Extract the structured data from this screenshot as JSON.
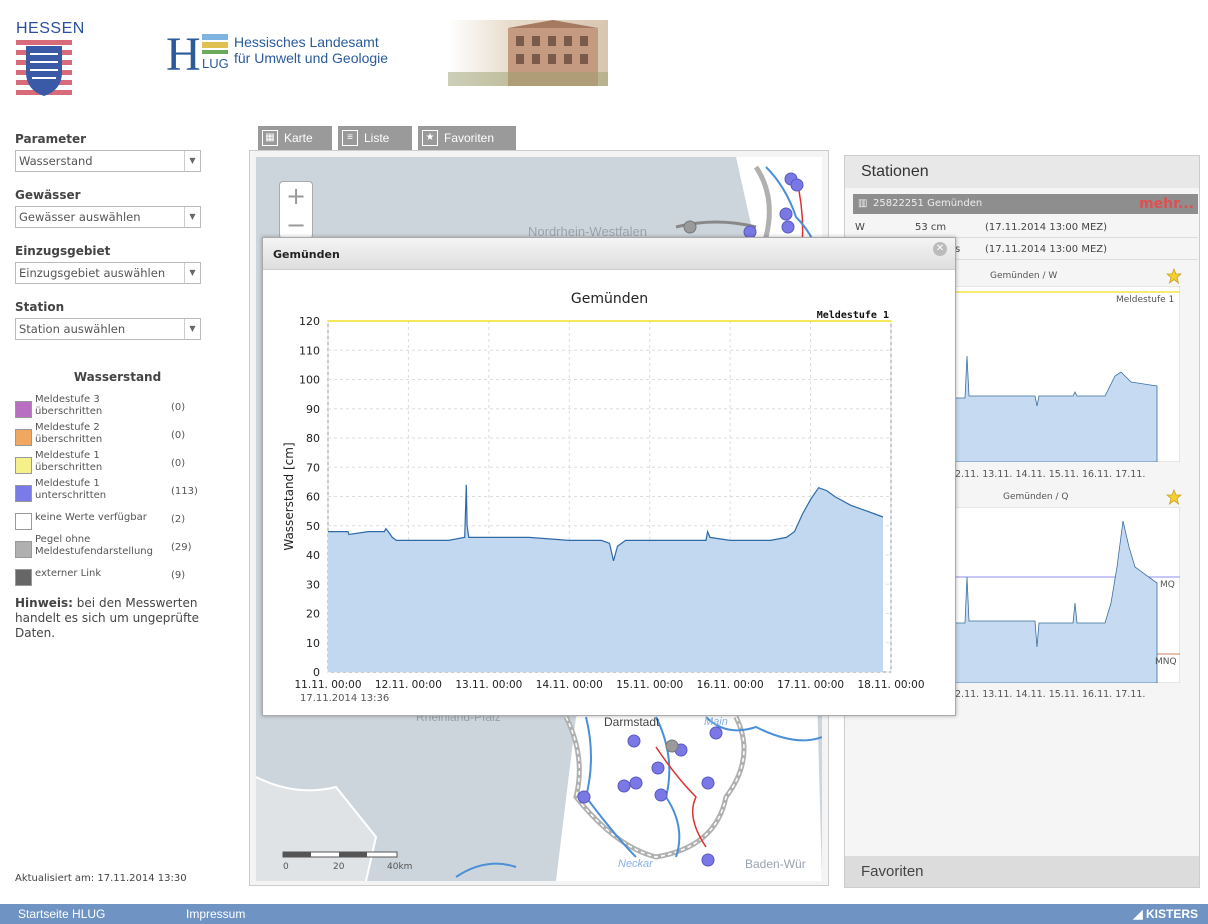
{
  "header": {
    "hessen_label": "HESSEN",
    "hlug_line1": "Hessisches Landesamt",
    "hlug_line2": "für Umwelt und Geologie",
    "hlug_logo_sub": "LUG"
  },
  "sidebar": {
    "parameter_label": "Parameter",
    "parameter_value": "Wasserstand",
    "gewaesser_label": "Gewässer",
    "gewaesser_value": "Gewässer auswählen",
    "einzugsgebiet_label": "Einzugsgebiet",
    "einzugsgebiet_value": "Einzugsgebiet auswählen",
    "station_label": "Station",
    "station_value": "Station auswählen",
    "legend_title": "Wasserstand",
    "legend": [
      {
        "line1": "Meldestufe 3",
        "line2": "überschritten",
        "count": "(0)",
        "color": "#b86fc1"
      },
      {
        "line1": "Meldestufe 2",
        "line2": "überschritten",
        "count": "(0)",
        "color": "#f0a860"
      },
      {
        "line1": "Meldestufe 1",
        "line2": "überschritten",
        "count": "(0)",
        "color": "#f5f08a"
      },
      {
        "line1": "Meldestufe 1",
        "line2": "unterschritten",
        "count": "(113)",
        "color": "#7a7ae8"
      },
      {
        "line1": "keine Werte verfügbar",
        "line2": "",
        "count": "(2)",
        "color": "#ffffff"
      },
      {
        "line1": "Pegel ohne",
        "line2": "Meldestufendarstellung",
        "count": "(29)",
        "color": "#b0b0b0"
      },
      {
        "line1": "externer Link",
        "line2": "",
        "count": "(9)",
        "color": "#666666"
      }
    ],
    "hint_bold": "Hinweis:",
    "hint_text": " bei den Messwerten handelt es sich um ungeprüfte Daten.",
    "updated": "Aktualisiert am: 17.11.2014  13:30"
  },
  "tabs": [
    {
      "label": "Karte",
      "icon": "map-icon"
    },
    {
      "label": "Liste",
      "icon": "list-icon"
    },
    {
      "label": "Favoriten",
      "icon": "star-icon"
    }
  ],
  "map": {
    "labels": {
      "nrw": "Nordrhein-Westfalen",
      "rlp": "Rheinland-Pfalz",
      "darmstadt": "Darmstadt",
      "main": "Main",
      "bw": "Baden-Wür",
      "neckar": "Neckar"
    },
    "scale": {
      "t0": "0",
      "t1": "20",
      "t2": "40km"
    },
    "zoom_in": "+",
    "zoom_out": "−"
  },
  "popup": {
    "title": "Gemünden",
    "timestamp": "17.11.2014  13:36"
  },
  "stations": {
    "header": "Stationen",
    "selected": "25822251 Gemünden",
    "mehr": "mehr...",
    "row1_param": "W",
    "row1_value": "53 cm",
    "row1_time": "(17.11.2014 13:00 MEZ)",
    "row2_param": "s",
    "row2_time": "(17.11.2014 13:00 MEZ)",
    "mini1_title": "Gemünden / W",
    "mini1_meldestufe": "Meldestufe 1",
    "mini2_title": "Gemünden / Q",
    "mini2_mq": "MQ",
    "mini2_mnq": "MNQ",
    "mini_xticks": [
      "2.11.",
      "13.11.",
      "14.11.",
      "15.11.",
      "16.11.",
      "17.11."
    ],
    "favoriten": "Favoriten"
  },
  "footer": {
    "link1": "Startseite HLUG",
    "link2": "Impressum",
    "brand": "KISTERS"
  },
  "chart_data": {
    "type": "area",
    "title": "Gemünden",
    "xlabel": "",
    "ylabel": "Wasserstand [cm]",
    "x_ticks": [
      "11.11. 00:00",
      "12.11. 00:00",
      "13.11. 00:00",
      "14.11. 00:00",
      "15.11. 00:00",
      "16.11. 00:00",
      "17.11. 00:00",
      "18.11. 00:00"
    ],
    "y_ticks": [
      0,
      10,
      20,
      30,
      40,
      50,
      60,
      70,
      80,
      90,
      100,
      110,
      120
    ],
    "ylim": [
      0,
      120
    ],
    "xlim_days": [
      0,
      7
    ],
    "threshold": {
      "label": "Meldestufe 1",
      "value": 120,
      "color": "#f0e020"
    },
    "series": [
      {
        "x_days": [
          0,
          0.25,
          0.26,
          0.5,
          0.7,
          0.72,
          0.75,
          0.8,
          0.85,
          1.0,
          1.5,
          1.7,
          1.72,
          1.73,
          1.75,
          1.8,
          2.0,
          2.5,
          3.0,
          3.4,
          3.5,
          3.55,
          3.6,
          3.7,
          4.0,
          4.5,
          4.7,
          4.72,
          4.75,
          5.0,
          5.5,
          5.7,
          5.8,
          5.9,
          6.0,
          6.1,
          6.2,
          6.3,
          6.5,
          6.7,
          6.8,
          6.9
        ],
        "values": [
          48,
          48,
          47,
          48,
          48,
          49,
          48,
          46,
          45,
          45,
          45,
          46,
          64,
          50,
          46,
          46,
          46,
          46,
          45,
          45,
          44,
          38,
          43,
          45,
          45,
          45,
          45,
          48,
          46,
          45,
          45,
          46,
          48,
          54,
          59,
          63,
          62,
          60,
          57,
          55,
          54,
          53
        ]
      }
    ]
  }
}
